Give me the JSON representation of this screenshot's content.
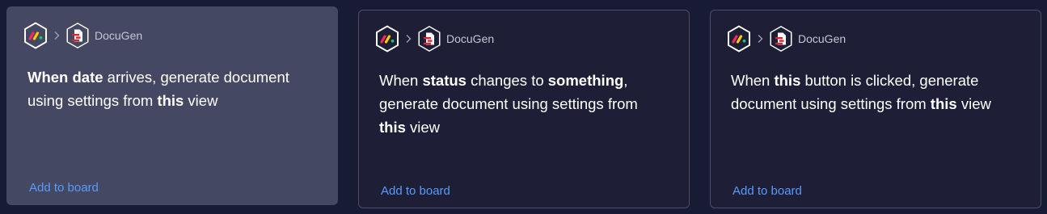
{
  "cards": [
    {
      "app_name": "DocuGen",
      "recipe": [
        {
          "text": "When date",
          "bold": true
        },
        {
          "text": " arrives, generate document using settings from ",
          "bold": false
        },
        {
          "text": "this",
          "bold": true
        },
        {
          "text": " view",
          "bold": false
        }
      ],
      "add_label": "Add to board",
      "state": "hover"
    },
    {
      "app_name": "DocuGen",
      "recipe": [
        {
          "text": "When ",
          "bold": false
        },
        {
          "text": "status",
          "bold": true
        },
        {
          "text": " changes to ",
          "bold": false
        },
        {
          "text": "something",
          "bold": true
        },
        {
          "text": ", generate document using settings from ",
          "bold": false
        },
        {
          "text": "this",
          "bold": true
        },
        {
          "text": " view",
          "bold": false
        }
      ],
      "add_label": "Add to board",
      "state": "default"
    },
    {
      "app_name": "DocuGen",
      "recipe": [
        {
          "text": "When ",
          "bold": false
        },
        {
          "text": "this",
          "bold": true
        },
        {
          "text": " button is clicked, generate document using settings from ",
          "bold": false
        },
        {
          "text": "this",
          "bold": true
        },
        {
          "text": " view",
          "bold": false
        }
      ],
      "add_label": "Add to board",
      "state": "default"
    }
  ],
  "icons": {
    "source": "monday-logo-icon",
    "separator": "chevron-right-icon",
    "target": "docugen-logo-icon"
  },
  "colors": {
    "page_bg": "#181b34",
    "card_bg": "#1e1f37",
    "card_hover_bg": "#454862",
    "link": "#579bfc",
    "monday_red": "#fb275d",
    "monday_yellow": "#ffcb00",
    "monday_green": "#00ca72"
  }
}
